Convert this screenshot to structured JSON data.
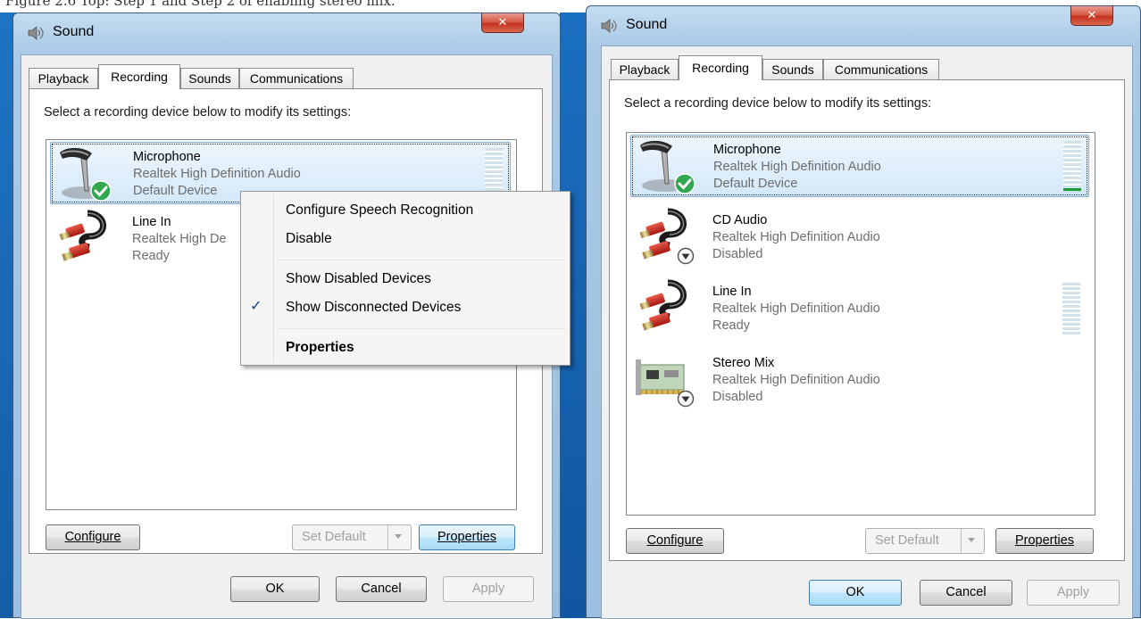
{
  "header_caption": "Figure 2.6 Top: Step 1 and Step 2 of enabling stereo mix.",
  "windows": [
    {
      "title": "Sound",
      "tabs": [
        "Playback",
        "Recording",
        "Sounds",
        "Communications"
      ],
      "active_tab": "Recording",
      "instruction": "Select a recording device below to modify its settings:",
      "devices": [
        {
          "name": "Microphone",
          "driver": "Realtek High Definition Audio",
          "status": "Default Device"
        },
        {
          "name": "Line In",
          "driver": "Realtek High De",
          "status": "Ready"
        }
      ],
      "context_menu": {
        "items": [
          "Configure Speech Recognition",
          "Disable",
          "Show Disabled Devices",
          "Show Disconnected Devices",
          "Properties"
        ],
        "checked": "Show Disconnected Devices",
        "bold": "Properties"
      },
      "buttons": {
        "configure": "Configure",
        "set_default": "Set Default",
        "properties": "Properties",
        "ok": "OK",
        "cancel": "Cancel",
        "apply": "Apply"
      }
    },
    {
      "title": "Sound",
      "tabs": [
        "Playback",
        "Recording",
        "Sounds",
        "Communications"
      ],
      "active_tab": "Recording",
      "instruction": "Select a recording device below to modify its settings:",
      "devices": [
        {
          "name": "Microphone",
          "driver": "Realtek High Definition Audio",
          "status": "Default Device"
        },
        {
          "name": "CD Audio",
          "driver": "Realtek High Definition Audio",
          "status": "Disabled"
        },
        {
          "name": "Line In",
          "driver": "Realtek High Definition Audio",
          "status": "Ready"
        },
        {
          "name": "Stereo Mix",
          "driver": "Realtek High Definition Audio",
          "status": "Disabled"
        }
      ],
      "buttons": {
        "configure": "Configure",
        "set_default": "Set Default",
        "properties": "Properties",
        "ok": "OK",
        "cancel": "Cancel",
        "apply": "Apply"
      }
    }
  ],
  "icons": {
    "close": "close-icon",
    "app": "speaker-icon",
    "microphone": "microphone-icon",
    "rca": "rca-cable-icon",
    "card": "sound-card-icon",
    "default_check": "green-check-icon",
    "disabled": "disabled-arrow-icon",
    "dropdown": "chevron-down-icon"
  },
  "colors": {
    "window_frame": "#a9c9e6",
    "desktop": "#1d74c4",
    "close": "#c4321f",
    "selection": "#d4e8fa",
    "meter": "#cfe1ea",
    "meter_level": "#1b9b3a",
    "default_check": "#2fa84f"
  }
}
